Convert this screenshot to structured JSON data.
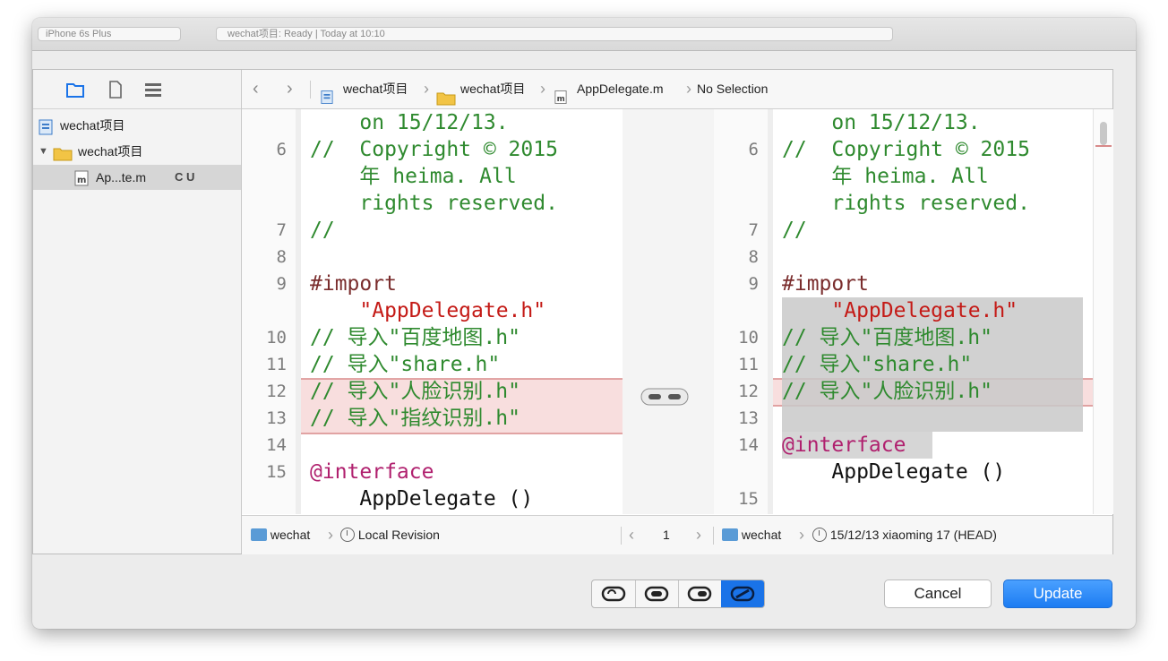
{
  "titlebar": {
    "scheme": "iPhone 6s Plus",
    "activity": "wechat项目: Ready  |  Today at 10:10"
  },
  "navigator": {
    "tabs": [
      "folder-icon",
      "document-icon",
      "list-icon"
    ],
    "items": [
      {
        "label": "wechat项目",
        "icon": "project-file-icon",
        "depth": 0
      },
      {
        "label": "wechat项目",
        "icon": "yellow-folder-icon",
        "depth": 1,
        "expanded": true
      },
      {
        "label": "Ap...te.m",
        "icon": "objc-m-file-icon",
        "depth": 2,
        "status": "C U",
        "selected": true
      }
    ]
  },
  "jumpbar": {
    "back": "‹",
    "forward": "›",
    "crumbs": [
      "wechat项目",
      "wechat项目",
      "AppDelegate.m",
      "No Selection"
    ]
  },
  "left_pane": {
    "lines": [
      {
        "n": "",
        "text": "    on 15/12/13.",
        "cls": "c-com"
      },
      {
        "n": "6",
        "text": "//  Copyright © 2015",
        "cls": "c-com"
      },
      {
        "n": "",
        "text": "    年 heima. All",
        "cls": "c-com"
      },
      {
        "n": "",
        "text": "    rights reserved.",
        "cls": "c-com"
      },
      {
        "n": "7",
        "text": "//",
        "cls": "c-com"
      },
      {
        "n": "8",
        "text": "",
        "cls": "c-pln"
      },
      {
        "n": "9",
        "text": "#import",
        "cls": "c-pre"
      },
      {
        "n": "",
        "text": "    \"AppDelegate.h\"",
        "cls": "c-str"
      },
      {
        "n": "10",
        "text": "// 导入\"百度地图.h\"",
        "cls": "c-com"
      },
      {
        "n": "11",
        "text": "// 导入\"share.h\"",
        "cls": "c-com"
      },
      {
        "n": "12",
        "text": "// 导入\"人脸识别.h\"",
        "cls": "c-com"
      },
      {
        "n": "13",
        "text": "// 导入\"指纹识别.h\"",
        "cls": "c-com"
      },
      {
        "n": "14",
        "text": "",
        "cls": "c-pln"
      },
      {
        "n": "15",
        "text": "@interface",
        "cls": "c-kw"
      },
      {
        "n": "",
        "text": "    AppDelegate ()",
        "cls": "c-pln"
      }
    ]
  },
  "right_pane": {
    "lines": [
      {
        "n": "",
        "text": "    on 15/12/13.",
        "cls": "c-com"
      },
      {
        "n": "6",
        "text": "//  Copyright © 2015",
        "cls": "c-com"
      },
      {
        "n": "",
        "text": "    年 heima. All",
        "cls": "c-com"
      },
      {
        "n": "",
        "text": "    rights reserved.",
        "cls": "c-com"
      },
      {
        "n": "7",
        "text": "//",
        "cls": "c-com"
      },
      {
        "n": "8",
        "text": "",
        "cls": "c-pln"
      },
      {
        "n": "9",
        "text": "#import",
        "cls": "c-pre"
      },
      {
        "n": "",
        "text": "    \"AppDelegate.h\"",
        "cls": "c-str"
      },
      {
        "n": "10",
        "text": "// 导入\"百度地图.h\"",
        "cls": "c-com"
      },
      {
        "n": "11",
        "text": "// 导入\"share.h\"",
        "cls": "c-com"
      },
      {
        "n": "12",
        "text": "// 导入\"人脸识别.h\"",
        "cls": "c-com"
      },
      {
        "n": "13",
        "text": "",
        "cls": "c-pln"
      },
      {
        "n": "14",
        "text": "@interface",
        "cls": "c-kw"
      },
      {
        "n": "",
        "text": "    AppDelegate ()",
        "cls": "c-pln"
      },
      {
        "n": "15",
        "text": "",
        "cls": "c-pln"
      }
    ]
  },
  "footer": {
    "left_repo": "wechat",
    "left_revision": "Local Revision",
    "change_index": "1",
    "right_repo": "wechat",
    "right_revision": "15/12/13  xiaoming  17 (HEAD)"
  },
  "toolbar": {
    "view_modes": [
      "ignore-whitespace-icon",
      "mode-icon-2",
      "mode-icon-3",
      "conflict-mode-icon"
    ],
    "active_mode": 3,
    "cancel_label": "Cancel",
    "update_label": "Update"
  },
  "colors": {
    "accent": "#1a73e8",
    "diff_highlight": "#f7d7d7",
    "comment": "#2f8a2f",
    "string": "#c41a16",
    "keyword": "#b0206e"
  }
}
